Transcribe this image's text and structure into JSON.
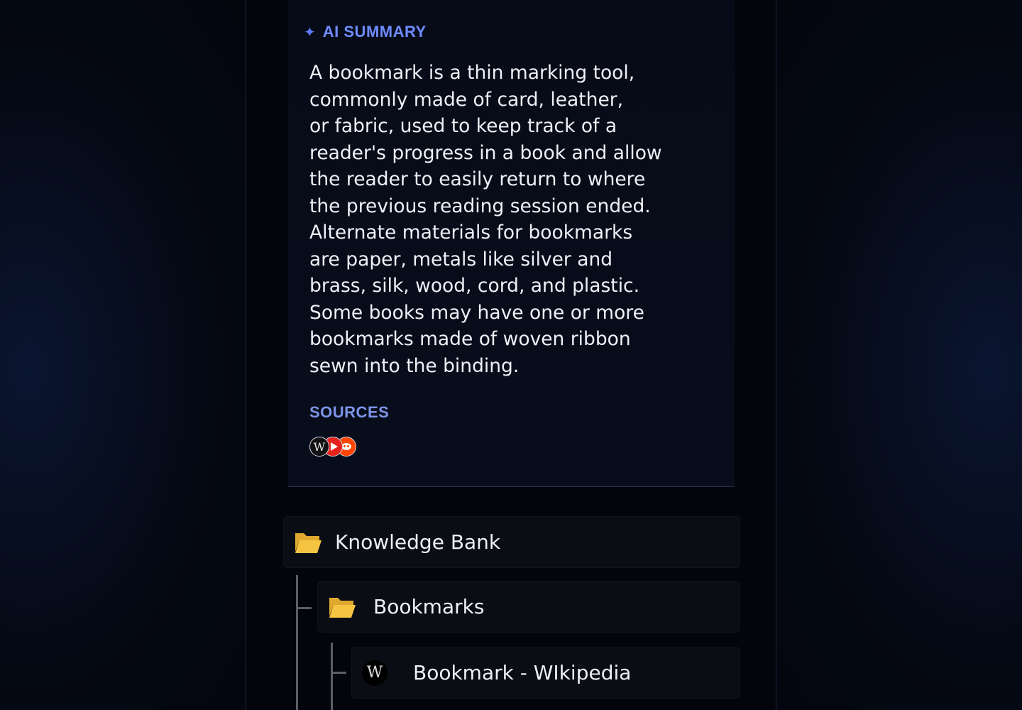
{
  "summary": {
    "title": "AI SUMMARY",
    "sparkle_icon": "sparkle-icon",
    "lines": [
      "A bookmark is a thin marking tool,",
      "commonly made of card, leather,",
      "or fabric, used to keep track of a",
      "reader's progress in a book and allow",
      "the reader to easily return to where",
      "the previous reading session ended.",
      "Alternate materials for bookmarks",
      "are paper, metals like silver and",
      "brass, silk, wood, cord, and plastic.",
      "Some books may have one or more",
      "bookmarks made of woven ribbon",
      "sewn into the binding."
    ]
  },
  "sources": {
    "title": "SOURCES",
    "icons": [
      "wikipedia-icon",
      "youtube-icon",
      "reddit-icon"
    ],
    "wiki_glyph": "W"
  },
  "tree": {
    "root": {
      "label": "Knowledge Bank",
      "icon": "folder-open-icon"
    },
    "child": {
      "label": "Bookmarks",
      "icon": "folder-open-icon"
    },
    "leaf": {
      "label": "Bookmark - WIkipedia",
      "icon": "wikipedia-icon",
      "glyph": "W"
    }
  },
  "colors": {
    "accent": "#6f8bff",
    "folder": "#f5c542",
    "background": "#03050b"
  }
}
